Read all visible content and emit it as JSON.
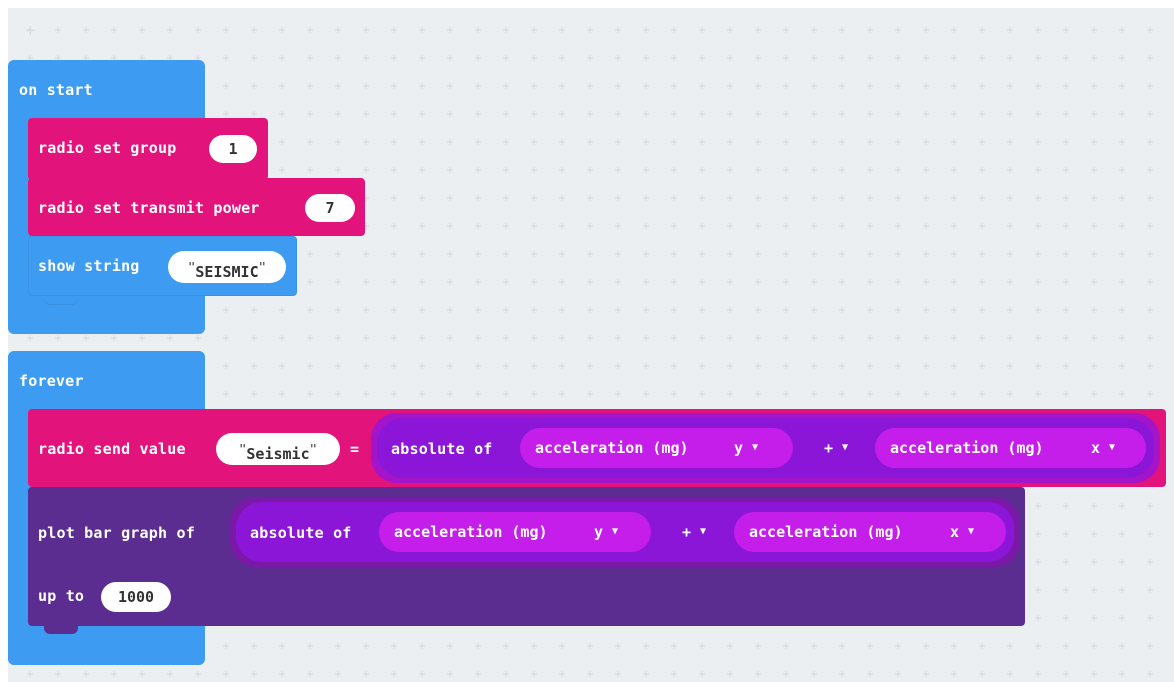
{
  "on_start": {
    "hat_label": "on start",
    "blocks": {
      "radio_group": {
        "label": "radio set group",
        "value": "1"
      },
      "transmit_power": {
        "label": "radio set transmit power",
        "value": "7"
      },
      "show_string": {
        "label": "show string",
        "value": "SEISMIC",
        "quote": "\""
      }
    }
  },
  "forever": {
    "hat_label": "forever",
    "send_value": {
      "label": "radio send value",
      "name": "Seismic",
      "quote": "\"",
      "equals": "=",
      "abs_label": "absolute of",
      "left_operand": "acceleration (mg)",
      "left_axis": "y",
      "operator": "+",
      "right_operand": "acceleration (mg)",
      "right_axis": "x"
    },
    "plot_bar": {
      "label": "plot bar graph of",
      "abs_label": "absolute of",
      "left_operand": "acceleration (mg)",
      "left_axis": "y",
      "operator": "+",
      "right_operand": "acceleration (mg)",
      "right_axis": "x",
      "up_to_label": "up to",
      "up_to_value": "1000"
    }
  },
  "icons": [
    "dropdown-arrow-icon"
  ],
  "colors": {
    "blue": "#3d9cf2",
    "pink": "#e3137c",
    "purple": "#5c2d91",
    "expr_outer_send": "#a414c9",
    "expr_inner_send": "#8b16d8",
    "operand_send": "#c51eeb",
    "canvas": "#eceff1"
  }
}
